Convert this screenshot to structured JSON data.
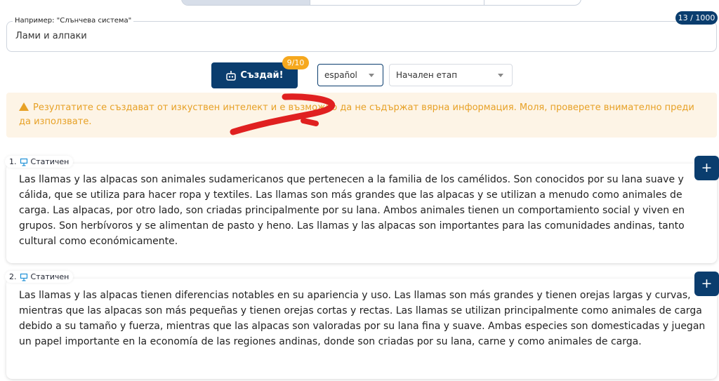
{
  "topic": {
    "placeholder_label": "Например: \"Слънчева система\"",
    "value": "Лами и алпаки",
    "char_count": "13 / 1000"
  },
  "toolbar": {
    "create_label": "Създай!",
    "quota": "9/10",
    "language": "español",
    "template": "Начален етап"
  },
  "warning": {
    "text": "Резултатите се създават от изкуствен интелект и е възможно да не съдържат вярна информация. Моля, проверете внимателно преди да използвате."
  },
  "cards": [
    {
      "number": "1.",
      "kind": "Статичен",
      "text": "Las llamas y las alpacas son animales sudamericanos que pertenecen a la familia de los camélidos. Son conocidos por su lana suave y cálida, que se utiliza para hacer ropa y textiles. Las llamas son más grandes que las alpacas y se utilizan a menudo como animales de carga. Las alpacas, por otro lado, son criadas principalmente por su lana. Ambos animales tienen un comportamiento social y viven en grupos. Son herbívoros y se alimentan de pasto y heno. Las llamas y las alpacas son importantes para las comunidades andinas, tanto cultural como económicamente."
    },
    {
      "number": "2.",
      "kind": "Статичен",
      "text": "Las llamas y las alpacas tienen diferencias notables en su apariencia y uso. Las llamas son más grandes y tienen orejas largas y curvas, mientras que las alpacas son más pequeñas y tienen orejas cortas y rectas. Las llamas se utilizan principalmente como animales de carga debido a su tamaño y fuerza, mientras que las alpacas son valoradas por su lana fina y suave. Ambas especies son domesticadas y juegan un papel importante en la economía de las regiones andinas, donde son criadas por su lana, carne y como animales de carga."
    }
  ],
  "colors": {
    "primary": "#0a3d6e",
    "badge": "#f6a81e",
    "warning_bg": "#fdf4e6",
    "warning_text": "#e7a126",
    "annotation": "#e02020"
  },
  "icons": {
    "create": "robot-icon",
    "card_kind": "presentation-icon",
    "warning": "warning-triangle-icon"
  }
}
